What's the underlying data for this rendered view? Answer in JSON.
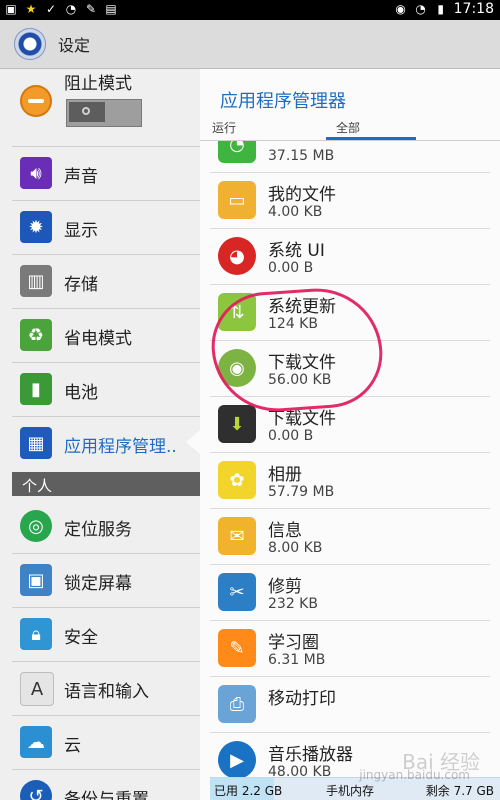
{
  "status_bar": {
    "time": "17:18",
    "left_icons": [
      "image-icon",
      "star-icon",
      "check-icon",
      "wifi-icon",
      "pencil-icon",
      "clipboard-icon"
    ],
    "right_icons": [
      "eye-icon",
      "signal-icon",
      "battery-icon"
    ]
  },
  "action_bar": {
    "title": "设定",
    "icon": "settings-app-icon"
  },
  "left_panel": {
    "blocking_mode": {
      "label": "阻止模式",
      "toggle": "off"
    },
    "items": [
      {
        "label": "声音",
        "icon": "speaker-icon",
        "color": "#6a2db5"
      },
      {
        "label": "显示",
        "icon": "gear-icon",
        "color": "#1d57b9"
      },
      {
        "label": "存储",
        "icon": "sdcard-icon",
        "color": "#7a7a7a"
      },
      {
        "label": "省电模式",
        "icon": "recycle-icon",
        "color": "#4aa43b"
      },
      {
        "label": "电池",
        "icon": "battery-icon",
        "color": "#3a9a35"
      },
      {
        "label": "应用程序管理..",
        "icon": "grid-icon",
        "color": "#1e5bbd",
        "selected": true
      }
    ],
    "section_personal": "个人",
    "personal_items": [
      {
        "label": "定位服务",
        "icon": "target-icon",
        "color": "#27a64d"
      },
      {
        "label": "锁定屏幕",
        "icon": "picture-icon",
        "color": "#3d83c5"
      },
      {
        "label": "安全",
        "icon": "lock-icon",
        "color": "#2f95d3"
      },
      {
        "label": "语言和输入",
        "icon": "keyboard-a-icon",
        "color": "#e5e5e5"
      },
      {
        "label": "云",
        "icon": "cloud-sync-icon",
        "color": "#2c8fd2"
      },
      {
        "label": "备份与重置",
        "icon": "backup-icon",
        "color": "#1b5eb8"
      }
    ]
  },
  "right_panel": {
    "title": "应用程序管理器",
    "tabs": [
      "运行",
      "全部"
    ],
    "active_tab": "全部",
    "apps": [
      {
        "name": "",
        "size": "37.15 MB",
        "icon": "wechat-icon",
        "color": "#3fb53f"
      },
      {
        "name": "我的文件",
        "size": "4.00 KB",
        "icon": "folder-icon",
        "color": "#f0b032"
      },
      {
        "name": "系统 UI",
        "size": "0.00 B",
        "icon": "android-red-icon",
        "color": "#d82624"
      },
      {
        "name": "系统更新",
        "size": "124 KB",
        "icon": "update-arrows-icon",
        "color": "#8cc63f"
      },
      {
        "name": "下载文件",
        "size": "56.00 KB",
        "icon": "android-green-icon",
        "color": "#7cb342"
      },
      {
        "name": "下载文件",
        "size": "0.00 B",
        "icon": "download-icon",
        "color": "#2f2f2f"
      },
      {
        "name": "相册",
        "size": "57.79 MB",
        "icon": "gallery-icon",
        "color": "#f2d42b"
      },
      {
        "name": "信息",
        "size": "8.00 KB",
        "icon": "message-icon",
        "color": "#f0b32b"
      },
      {
        "name": "修剪",
        "size": "232 KB",
        "icon": "scissors-icon",
        "color": "#2d7fc5"
      },
      {
        "name": "学习圈",
        "size": "6.31 MB",
        "icon": "notebook-icon",
        "color": "#ff8a1a"
      },
      {
        "name": "移动打印",
        "size": "",
        "icon": "printer-icon",
        "color": "#6aa4d6"
      },
      {
        "name": "音乐播放器",
        "size": "48.00 KB",
        "icon": "music-player-icon",
        "color": "#1a72c4"
      }
    ]
  },
  "storage": {
    "used_label": "已用 2.2 GB",
    "center_label": "手机内存",
    "free_label": "剩余 7.7 GB",
    "used_fraction": 0.22
  },
  "watermark": {
    "text": "Bai 经验",
    "subtext": "jingyan.baidu.com"
  }
}
